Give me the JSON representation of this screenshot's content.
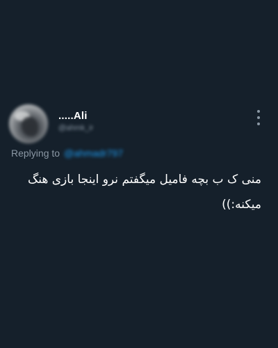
{
  "tweet": {
    "display_name": ".....Ali",
    "handle": "@ahmk_ir",
    "reply_prefix": "Replying to",
    "reply_to": "@ahmadr797",
    "text": "منی ک ب بچه فامیل میگفتم نرو اینجا بازی هنگ میکنه:))",
    "more_icon": "more-vertical-icon",
    "colors": {
      "background": "#15202b",
      "text": "#ffffff",
      "muted": "#8b98a5",
      "link": "#1d9bf0"
    }
  }
}
